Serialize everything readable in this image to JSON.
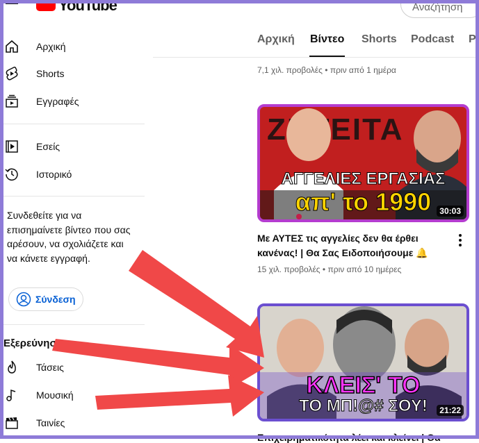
{
  "header": {
    "logo_text": "YouTube",
    "search_placeholder": "Αναζήτηση"
  },
  "sidebar": {
    "items": [
      {
        "label": "Αρχική",
        "icon": "home-icon"
      },
      {
        "label": "Shorts",
        "icon": "shorts-icon"
      },
      {
        "label": "Εγγραφές",
        "icon": "subscriptions-icon"
      },
      {
        "label": "Εσείς",
        "icon": "you-icon"
      },
      {
        "label": "Ιστορικό",
        "icon": "history-icon"
      }
    ],
    "signin_prompt": "Συνδεθείτε για να επισημαίνετε βίντεο που σας αρέσουν, να σχολιάζετε και να κάνετε εγγραφή.",
    "signin_button": "Σύνδεση",
    "explore_title": "Εξερεύνηση",
    "explore_items": [
      {
        "label": "Τάσεις",
        "icon": "trending-icon"
      },
      {
        "label": "Μουσική",
        "icon": "music-icon"
      },
      {
        "label": "Ταινίες",
        "icon": "movies-icon"
      }
    ]
  },
  "tabs": [
    {
      "label": "Αρχική",
      "active": false
    },
    {
      "label": "Βίντεο",
      "active": true
    },
    {
      "label": "Shorts",
      "active": false
    },
    {
      "label": "Podcast",
      "active": false
    },
    {
      "label": "P",
      "active": false
    }
  ],
  "videos": [
    {
      "meta_views": "7,1 χιλ. προβολές",
      "meta_sep": "•",
      "meta_time": "πριν από 1 ημέρα"
    },
    {
      "title": "Με ΑΥΤΕΣ τις αγγελίες δεν θα έρθει κανένας! | Θα Σας Ειδοποιήσουμε 🔔",
      "meta_views": "15 χιλ. προβολές",
      "meta_sep": "•",
      "meta_time": "πριν από 10 ημέρες",
      "duration": "30:03",
      "thumb_text_top": "ΑΓΓΕΛΙΕΣ ΕΡΓΑΣΙΑΣ",
      "thumb_text_bottom": "απ' το 1990",
      "thumb_bg_text": "ΖΗΤΕΙΤΑ"
    },
    {
      "title": "Επιχειρηματικότητα λέει και κλείνει | Θα",
      "duration": "21:22",
      "thumb_text_top": "ΚΛΕΙΣ' ΤΟ",
      "thumb_text_bottom": "ΤΟ ΜΠ!@# ΣΟΥ!"
    }
  ],
  "colors": {
    "frame": "#8e7bd8",
    "annotation_arrow": "#f04848",
    "thumb1_border": "#b43ccf",
    "thumb2_border": "#6b4fd0",
    "link_blue": "#065fd4",
    "youtube_red": "#ff0000"
  }
}
